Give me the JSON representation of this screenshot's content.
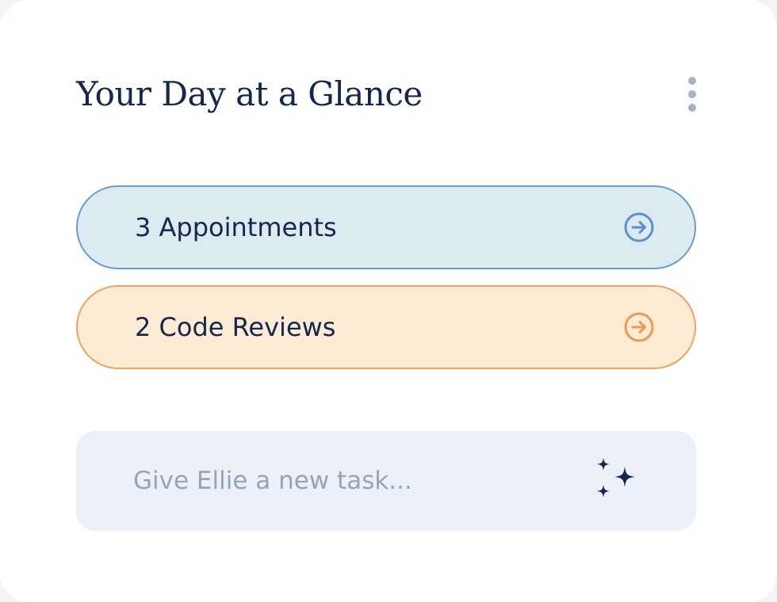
{
  "card": {
    "title": "Your Day at a Glance",
    "menu_icon": "more-vertical-icon"
  },
  "summary": [
    {
      "label": "3 Appointments",
      "icon": "arrow-right-circle-icon",
      "background": "#dbebf0",
      "border": "#6b9bd1",
      "icon_color": "#5b8fd0"
    },
    {
      "label": "2 Code Reviews",
      "icon": "arrow-right-circle-icon",
      "background": "#fdebd3",
      "border": "#f0a261",
      "icon_color": "#ef9850"
    }
  ],
  "task_input": {
    "value": "",
    "placeholder": "Give Ellie a new task...",
    "action_icon": "sparkles-icon"
  },
  "colors": {
    "text_primary": "#13274f",
    "placeholder": "#97a4b5",
    "input_background": "#ecf1f9",
    "menu_dots": "#a8b2c1"
  }
}
